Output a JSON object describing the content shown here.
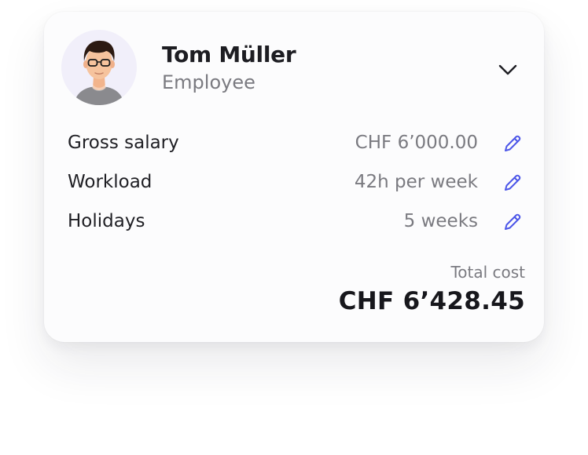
{
  "employee": {
    "name": "Tom Müller",
    "role": "Employee"
  },
  "rows": [
    {
      "label": "Gross salary",
      "value": "CHF 6’000.00"
    },
    {
      "label": "Workload",
      "value": "42h per week"
    },
    {
      "label": "Holidays",
      "value": "5 weeks"
    }
  ],
  "total": {
    "label": "Total cost",
    "value": "CHF 6’428.45"
  },
  "colors": {
    "accent": "#4c56e8",
    "text_primary": "#1d1d22",
    "text_secondary": "#7a7a80",
    "card_background": "#fcfcfd"
  },
  "icons": {
    "expand": "chevron-down-icon",
    "edit": "pencil-icon",
    "avatar": "person-avatar"
  }
}
